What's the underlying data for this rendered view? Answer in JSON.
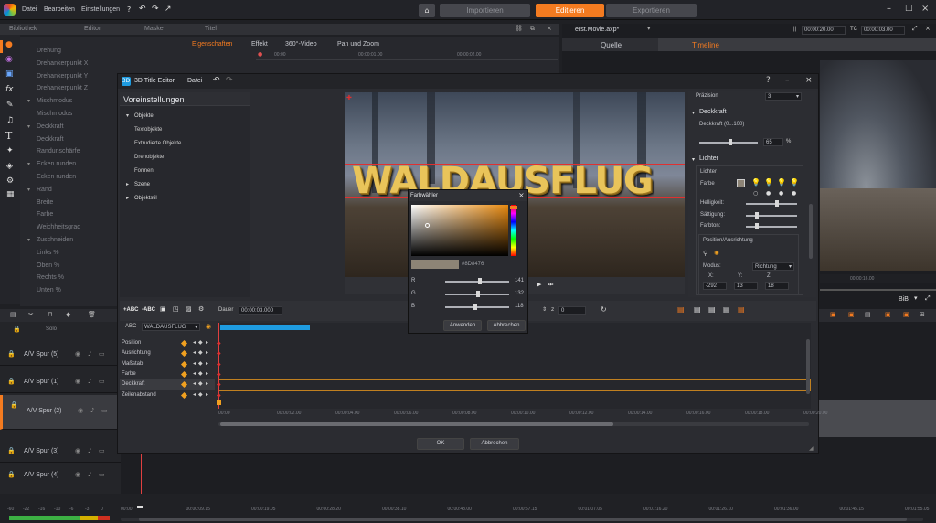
{
  "menubar": {
    "items": [
      "Datei",
      "Bearbeiten",
      "Einstellungen"
    ],
    "tabs": [
      "Importieren",
      "Editieren",
      "Exportieren"
    ]
  },
  "library": {
    "tabs": [
      "Bibliothek",
      "Editor",
      "Maske",
      "Titel"
    ],
    "subtabs": [
      "Eigenschaften",
      "Effekt",
      "360°-Video",
      "Pan und Zoom"
    ],
    "timecodes": [
      "00:00",
      "00:00:01.00",
      "00:00:02.00"
    ]
  },
  "properties": [
    "Drehung",
    "Drehankerpunkt X",
    "Drehankerpunkt Y",
    "Drehankerpunkt Z",
    "Mischmodus",
    "Mischmodus",
    "Deckkraft",
    "Deckkraft",
    "Randunschärfe",
    "Ecken runden",
    "Ecken runden",
    "Rand",
    "Breite",
    "Farbe",
    "Weichheitsgrad",
    "Zuschneiden",
    "Links %",
    "Oben %",
    "Rechts %",
    "Unten %"
  ],
  "player": {
    "project": "erst.Movie.axp*",
    "tabs": [
      "Quelle",
      "Timeline"
    ],
    "time1": "00:00:20.00",
    "tc_label": "TC",
    "time2": "00:00:03.00",
    "bib": "BiB",
    "preview_tc": "00:00:16.00"
  },
  "editor": {
    "title": "3D Title Editor",
    "menu": "Datei",
    "presets_title": "Voreinstellungen",
    "tree": [
      "Objekte",
      "Textobjekte",
      "Extrudierte Objekte",
      "Drehobjekte",
      "Formen",
      "Szene",
      "Objektstil"
    ],
    "preview_text": "WALDAUSFLUG",
    "ok": "OK",
    "cancel": "Abbrechen"
  },
  "right_panel": {
    "precision_label": "Präzision",
    "precision_value": "3",
    "opacity_title": "Deckkraft",
    "opacity_range": "Deckkraft (0...100)",
    "opacity_value": "65",
    "percent": "%",
    "lights_title": "Lichter",
    "lights_label": "Lichter",
    "color_label": "Farbe",
    "brightness_label": "Helligkeit:",
    "saturation_label": "Sättigung:",
    "hue_label": "Farbton:",
    "pos_title": "Position/Ausrichtung",
    "mode_label": "Modus:",
    "mode_value": "Richtung",
    "x_label": "X:",
    "y_label": "Y:",
    "z_label": "Z:",
    "x_value": "-292",
    "y_value": "13",
    "z_value": "18"
  },
  "colorpicker": {
    "title": "Farbwähler",
    "hex": "#8D8476",
    "r_label": "R",
    "g_label": "G",
    "b_label": "B",
    "r": "141",
    "g": "132",
    "b": "118",
    "apply": "Anwenden",
    "cancel": "Abbrechen",
    "r_pct": 0.553,
    "g_pct": 0.518,
    "b_pct": 0.463
  },
  "keyframes": {
    "abc1": "+ABC",
    "abc2": "-ABC",
    "duration_label": "Dauer",
    "duration": "00:00:03.000",
    "object_label": "ABC",
    "object": "WALDAUSFLUG",
    "rows": [
      "Position",
      "Ausrichtung",
      "Maßstab",
      "Farbe",
      "Deckkraft",
      "Zeilenabstand"
    ],
    "spin": "0",
    "ruler": [
      "00:00",
      "00:00:02.00",
      "00:00:04.00",
      "00:00:06.00",
      "00:00:08.00",
      "00:00:10.00",
      "00:00:12.00",
      "00:00:14.00",
      "00:00:16.00",
      "00:00:18.00",
      "00:00:20.00"
    ]
  },
  "timeline": {
    "header": "Solo",
    "tracks": [
      "A/V Spur (5)",
      "A/V Spur (1)",
      "A/V Spur (2)",
      "A/V Spur (3)",
      "A/V Spur (4)"
    ],
    "ruler": [
      "00:00",
      "00:00:09.15",
      "00:00:19.05",
      "00:00:28.20",
      "00:00:38.10",
      "00:00:48.00",
      "00:00:57.15",
      "00:01:07.05",
      "00:01:16.20",
      "00:01:26.10",
      "00:01:36.00",
      "00:01:45.15",
      "00:01:55.05"
    ],
    "levels": [
      "-60",
      "-22",
      "-16",
      "-10",
      "-6",
      "-3",
      "0"
    ]
  },
  "colors": {
    "accent": "#f47b20",
    "blue": "#1e9be0",
    "picked": "#8D8476"
  }
}
